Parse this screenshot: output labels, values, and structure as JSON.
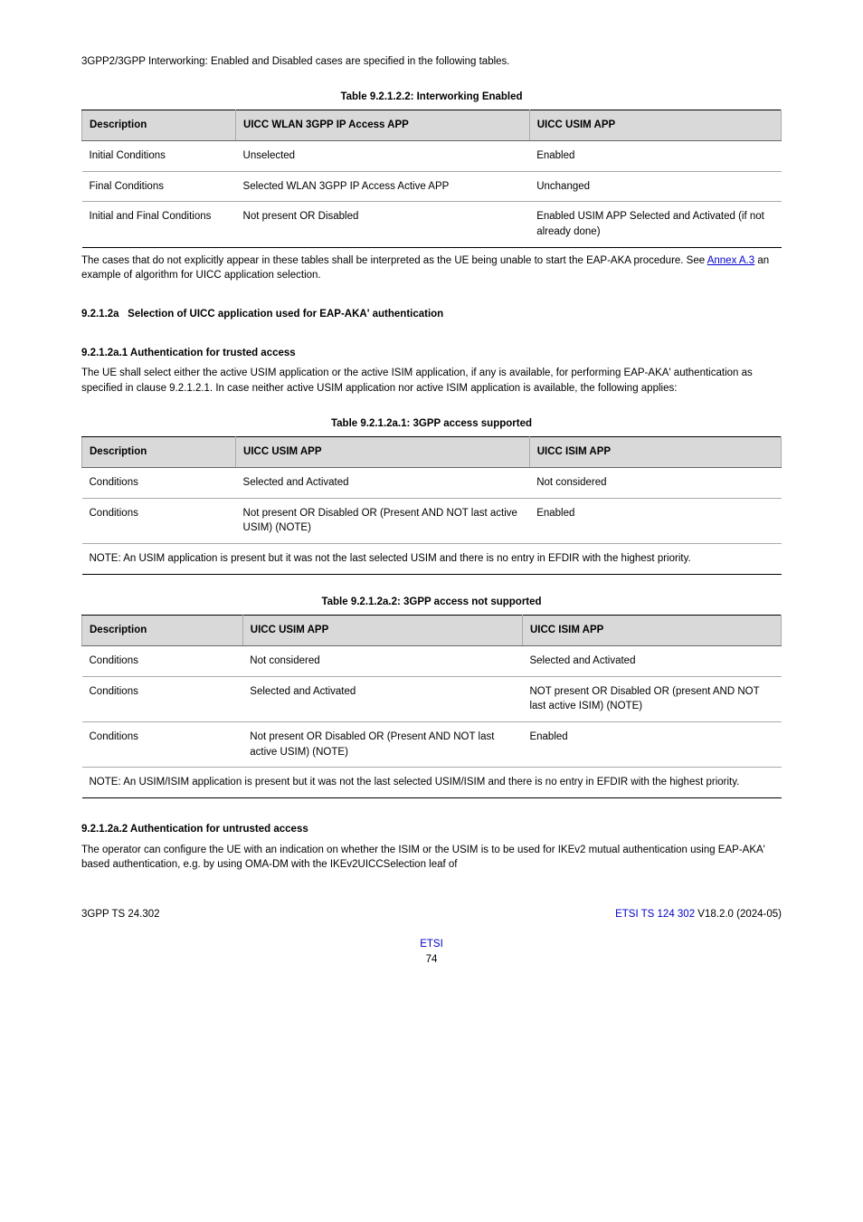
{
  "para1": "3GPP2/3GPP Interworking: Enabled and Disabled cases are specified in the following tables.",
  "table122": {
    "title": "Table 9.2.1.2.2: Interworking Enabled",
    "headers": [
      "Description",
      "UICC WLAN 3GPP IP Access APP",
      "UICC USIM APP"
    ],
    "rows": [
      [
        "Initial Conditions",
        "Unselected",
        "Enabled"
      ],
      [
        "Final Conditions",
        "Selected WLAN 3GPP IP Access Active APP",
        "Unchanged"
      ],
      [
        "Initial and Final Conditions",
        "Not present OR Disabled",
        "Enabled USIM APP Selected and Activated (if not already done)"
      ]
    ]
  },
  "table_note_pre": "The cases that do not explicitly appear in these tables shall be interpreted as the UE being unable to start the EAP-AKA procedure. See",
  "table_note_link": "Annex A.3",
  "table_note_post": " an example of algorithm for UICC application selection.",
  "heading921_num": "9.2.1.2a",
  "heading921_txt": "Selection of UICC application used for EAP-AKA' authentication",
  "heading921a1": "9.2.1.2a.1  Authentication for trusted access",
  "heading921a1_body": "The UE shall select either the active USIM application or the active ISIM application, if any is available, for performing EAP-AKA' authentication as specified in clause 9.2.1.2.1. In case neither active USIM application nor active ISIM application is available, the following applies:",
  "table12a1": {
    "title": "Table 9.2.1.2a.1: 3GPP access supported",
    "headers": [
      "Description",
      "UICC USIM APP",
      "UICC ISIM APP"
    ],
    "rows": [
      [
        "Conditions",
        "Selected and Activated",
        "Not considered"
      ],
      [
        "Conditions",
        "Not present OR Disabled OR (Present AND NOT last active USIM) (NOTE)",
        "Enabled"
      ]
    ],
    "note": "NOTE: An USIM application is present but it was not the last selected USIM and there is no entry in EFDIR with the highest priority."
  },
  "table12a2": {
    "title": "Table 9.2.1.2a.2: 3GPP access not supported",
    "headers": [
      "Description",
      "UICC USIM APP",
      "UICC ISIM APP"
    ],
    "rows": [
      [
        "Conditions",
        "Not considered",
        "Selected and Activated"
      ],
      [
        "Conditions",
        "Selected and Activated",
        "NOT present OR Disabled OR (present AND NOT last active ISIM) (NOTE)"
      ],
      [
        "Conditions",
        "Not present OR Disabled OR (Present AND NOT last active USIM) (NOTE)",
        "Enabled"
      ]
    ],
    "note": "NOTE: An USIM/ISIM application is present but it was not the last selected USIM/ISIM and there is no entry in EFDIR with the highest priority."
  },
  "heading921a2": "9.2.1.2a.2  Authentication for untrusted access",
  "heading921a2_body": "The operator can configure the UE with an indication on whether the ISIM or the USIM is to be used for IKEv2 mutual authentication using EAP-AKA' based authentication, e.g. by using OMA-DM with the IKEv2UICCSelection leaf of",
  "footer": {
    "left": "3GPP TS 24.302",
    "right_label": "ETSI TS 124 302 ",
    "right_version": "V18.2.0 (2024-05)",
    "link_inline": "ETSI",
    "pagenum": "74"
  }
}
